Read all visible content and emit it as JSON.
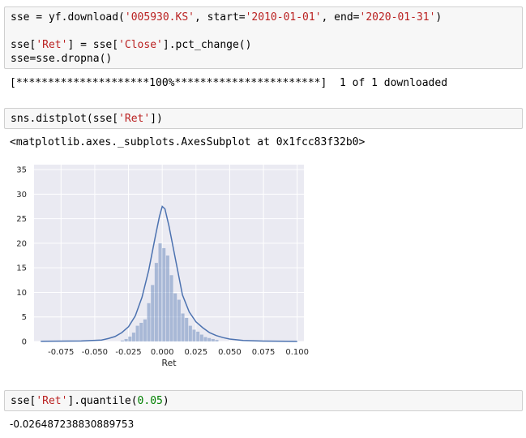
{
  "cells": [
    {
      "lines": [
        [
          {
            "t": "sse = yf.download(",
            "c": "p"
          },
          {
            "t": "'005930.KS'",
            "c": "s"
          },
          {
            "t": ", start=",
            "c": "p"
          },
          {
            "t": "'2010-01-01'",
            "c": "s"
          },
          {
            "t": ", end=",
            "c": "p"
          },
          {
            "t": "'2020-01-31'",
            "c": "s"
          },
          {
            "t": ")",
            "c": "p"
          }
        ],
        [],
        [
          {
            "t": "sse[",
            "c": "p"
          },
          {
            "t": "'Ret'",
            "c": "s"
          },
          {
            "t": "] = sse[",
            "c": "p"
          },
          {
            "t": "'Close'",
            "c": "s"
          },
          {
            "t": "].pct_change()",
            "c": "p"
          }
        ],
        [
          {
            "t": "sse=sse.dropna()",
            "c": "p"
          }
        ]
      ],
      "output": "[*********************100%***********************]  1 of 1 downloaded"
    },
    {
      "lines": [
        [
          {
            "t": "sns.distplot(sse[",
            "c": "p"
          },
          {
            "t": "'Ret'",
            "c": "s"
          },
          {
            "t": "])",
            "c": "p"
          }
        ]
      ],
      "output": "<matplotlib.axes._subplots.AxesSubplot at 0x1fcc83f32b0>"
    },
    {
      "lines": [
        [
          {
            "t": "sse[",
            "c": "p"
          },
          {
            "t": "'Ret'",
            "c": "s"
          },
          {
            "t": "].quantile(",
            "c": "p"
          },
          {
            "t": "0.05",
            "c": "n"
          },
          {
            "t": ")",
            "c": "p"
          }
        ]
      ],
      "output": "-0.026487238830889753"
    }
  ],
  "chart_data": {
    "type": "bar",
    "xlabel": "Ret",
    "ylabel": "",
    "xlim": [
      -0.095,
      0.105
    ],
    "ylim": [
      0,
      36
    ],
    "xticks": [
      "-0.075",
      "-0.050",
      "-0.025",
      "0.000",
      "0.025",
      "0.050",
      "0.075",
      "0.100"
    ],
    "xtick_values": [
      -0.075,
      -0.05,
      -0.025,
      0.0,
      0.025,
      0.05,
      0.075,
      0.1
    ],
    "yticks": [
      0,
      5,
      10,
      15,
      20,
      25,
      30,
      35
    ],
    "grid": true,
    "bin_width": 0.0028,
    "bins": [
      {
        "x": -0.0294,
        "v": 0.2
      },
      {
        "x": -0.0266,
        "v": 0.5
      },
      {
        "x": -0.0238,
        "v": 1.0
      },
      {
        "x": -0.021,
        "v": 1.8
      },
      {
        "x": -0.0182,
        "v": 3.2
      },
      {
        "x": -0.0154,
        "v": 3.8
      },
      {
        "x": -0.0126,
        "v": 4.5
      },
      {
        "x": -0.0098,
        "v": 7.8
      },
      {
        "x": -0.007,
        "v": 11.5
      },
      {
        "x": -0.0042,
        "v": 16.0
      },
      {
        "x": -0.0014,
        "v": 20.0
      },
      {
        "x": 0.0014,
        "v": 19.0
      },
      {
        "x": 0.0042,
        "v": 17.5
      },
      {
        "x": 0.007,
        "v": 13.5
      },
      {
        "x": 0.0098,
        "v": 9.8
      },
      {
        "x": 0.0126,
        "v": 8.5
      },
      {
        "x": 0.0154,
        "v": 5.7
      },
      {
        "x": 0.0182,
        "v": 4.8
      },
      {
        "x": 0.021,
        "v": 3.2
      },
      {
        "x": 0.0238,
        "v": 2.4
      },
      {
        "x": 0.0266,
        "v": 2.0
      },
      {
        "x": 0.0294,
        "v": 1.4
      },
      {
        "x": 0.0322,
        "v": 0.9
      },
      {
        "x": 0.035,
        "v": 0.7
      },
      {
        "x": 0.0378,
        "v": 0.5
      },
      {
        "x": 0.0406,
        "v": 0.3
      }
    ],
    "kde": [
      [
        -0.09,
        0.05
      ],
      [
        -0.06,
        0.1
      ],
      [
        -0.045,
        0.3
      ],
      [
        -0.04,
        0.6
      ],
      [
        -0.035,
        1.0
      ],
      [
        -0.03,
        1.8
      ],
      [
        -0.025,
        3.0
      ],
      [
        -0.02,
        5.2
      ],
      [
        -0.015,
        9.0
      ],
      [
        -0.01,
        14.5
      ],
      [
        -0.005,
        21.5
      ],
      [
        -0.002,
        25.5
      ],
      [
        0.0,
        27.5
      ],
      [
        0.002,
        27.0
      ],
      [
        0.005,
        23.5
      ],
      [
        0.01,
        16.5
      ],
      [
        0.015,
        9.5
      ],
      [
        0.02,
        6.0
      ],
      [
        0.025,
        4.0
      ],
      [
        0.03,
        2.8
      ],
      [
        0.035,
        1.8
      ],
      [
        0.04,
        1.2
      ],
      [
        0.045,
        0.8
      ],
      [
        0.05,
        0.5
      ],
      [
        0.06,
        0.2
      ],
      [
        0.075,
        0.08
      ],
      [
        0.1,
        0.02
      ]
    ]
  }
}
